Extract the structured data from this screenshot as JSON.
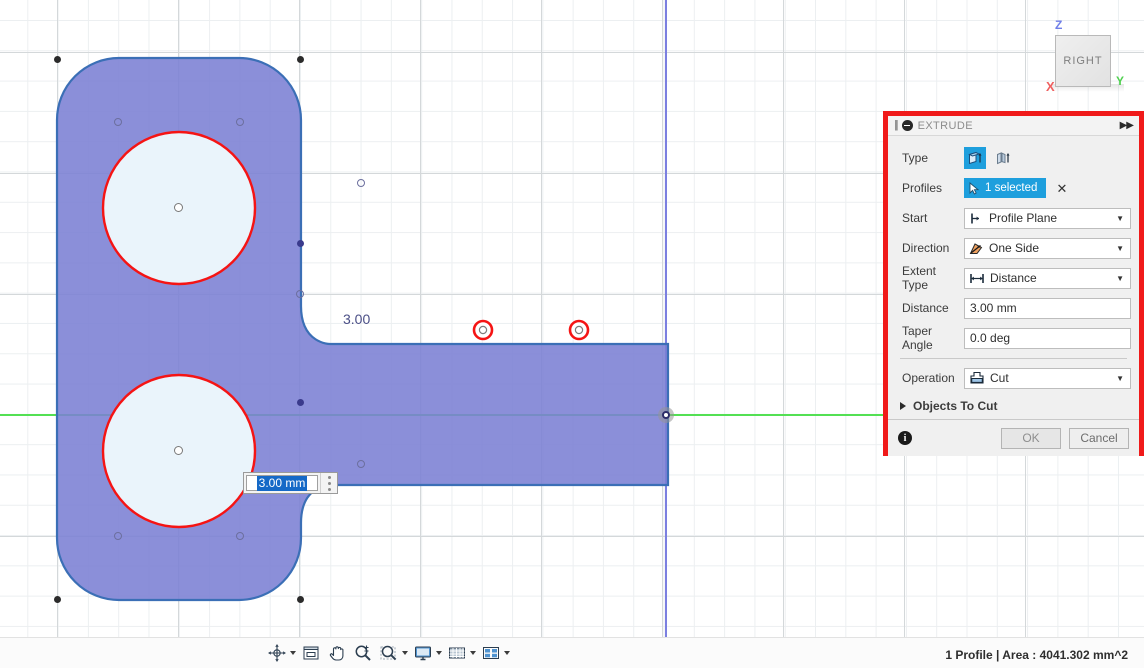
{
  "viewport": {
    "sketch_dimension_label": "3.00",
    "manipulator_value": "3.00 mm"
  },
  "viewcube": {
    "face_label": "RIGHT",
    "axis_z": "Z",
    "axis_y": "Y",
    "axis_x": "X",
    "colors": {
      "z": "#6f7ee8",
      "y": "#4fd04f",
      "x": "#ef6060"
    }
  },
  "dialog": {
    "title": "EXTRUDE",
    "highlight_border_color": "#f01a1a",
    "accent_color": "#1e9fdd",
    "rows": {
      "type": {
        "label": "Type",
        "options": [
          "extrude-solid-icon",
          "extrude-thin-icon"
        ],
        "selected_index": 0
      },
      "profiles": {
        "label": "Profiles",
        "value": "1 selected",
        "clear_label": "✕"
      },
      "start": {
        "label": "Start",
        "value": "Profile Plane",
        "icon": "profile-plane-icon"
      },
      "direction": {
        "label": "Direction",
        "value": "One Side",
        "icon": "one-side-icon"
      },
      "extent_type": {
        "label": "Extent Type",
        "value": "Distance",
        "icon": "distance-icon"
      },
      "distance": {
        "label": "Distance",
        "value": "3.00 mm"
      },
      "taper_angle": {
        "label": "Taper Angle",
        "value": "0.0 deg"
      },
      "operation": {
        "label": "Operation",
        "value": "Cut",
        "icon": "cut-icon"
      },
      "objects_to_cut": {
        "label": "Objects To Cut"
      }
    },
    "footer": {
      "info_label": "i",
      "ok_label": "OK",
      "cancel_label": "Cancel"
    }
  },
  "bottom_bar": {
    "status": "1 Profile | Area : 4041.302 mm^2",
    "nav_tools": [
      {
        "name": "orbit-icon",
        "has_dropdown": true
      },
      {
        "name": "look-at-icon",
        "has_dropdown": false
      },
      {
        "name": "pan-icon",
        "has_dropdown": false
      },
      {
        "name": "zoom-icon",
        "has_dropdown": false
      },
      {
        "name": "zoom-window-icon",
        "has_dropdown": true
      },
      {
        "name": "display-settings-icon",
        "has_dropdown": true
      },
      {
        "name": "grid-snaps-icon",
        "has_dropdown": true
      },
      {
        "name": "viewports-icon",
        "has_dropdown": true
      }
    ]
  },
  "sketch": {
    "profile_fill": "#7b7fd4",
    "profile_edge": "#3b6fb6",
    "hole_edge": "#f51414",
    "hole_fill": "#eaf4fb"
  }
}
